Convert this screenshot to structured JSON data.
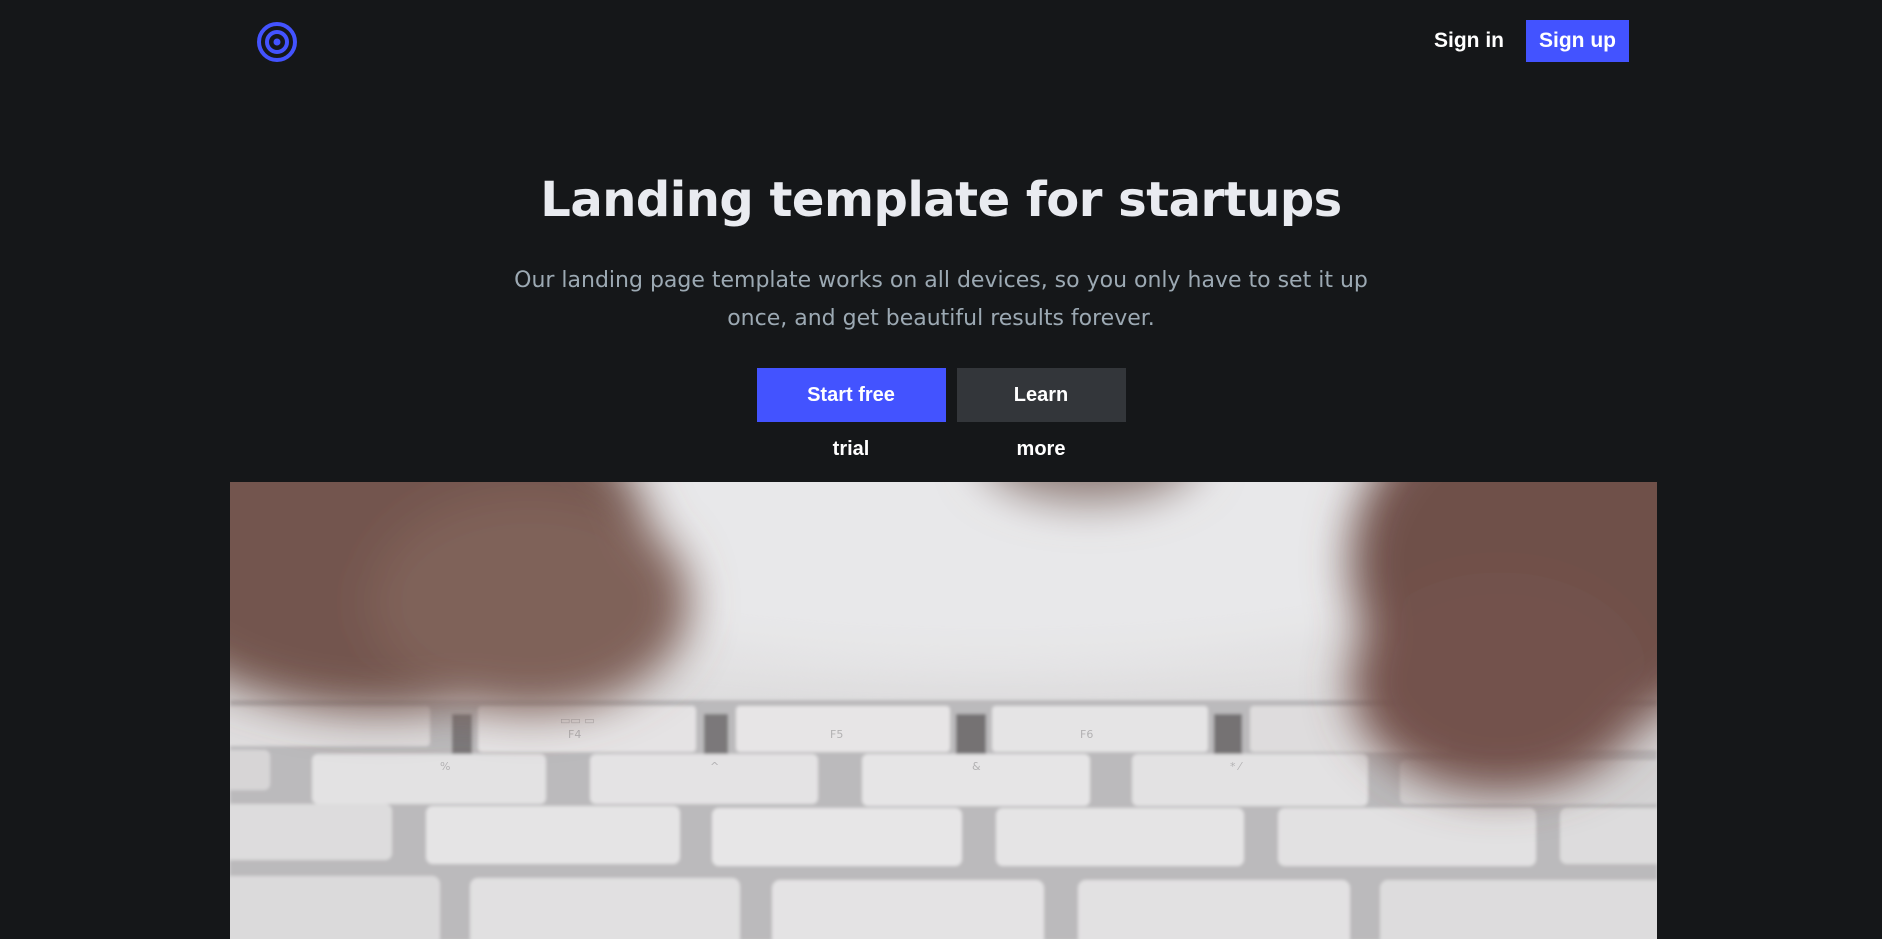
{
  "header": {
    "logo_icon": "target-logo-icon",
    "signin_label": "Sign in",
    "signup_label": "Sign up"
  },
  "hero": {
    "title": "Landing template for startups",
    "subtitle": "Our landing page template works on all devices, so you only have to set it up once, and get beautiful results forever.",
    "primary_cta": "Start free trial",
    "secondary_cta": "Learn more"
  },
  "media": {
    "image": "keyboard-typing-photo"
  },
  "colors": {
    "background": "#151719",
    "accent": "#4353ff",
    "secondary_button": "#33363a",
    "title": "#e9ebf0",
    "subtitle": "#9ca9b3"
  }
}
